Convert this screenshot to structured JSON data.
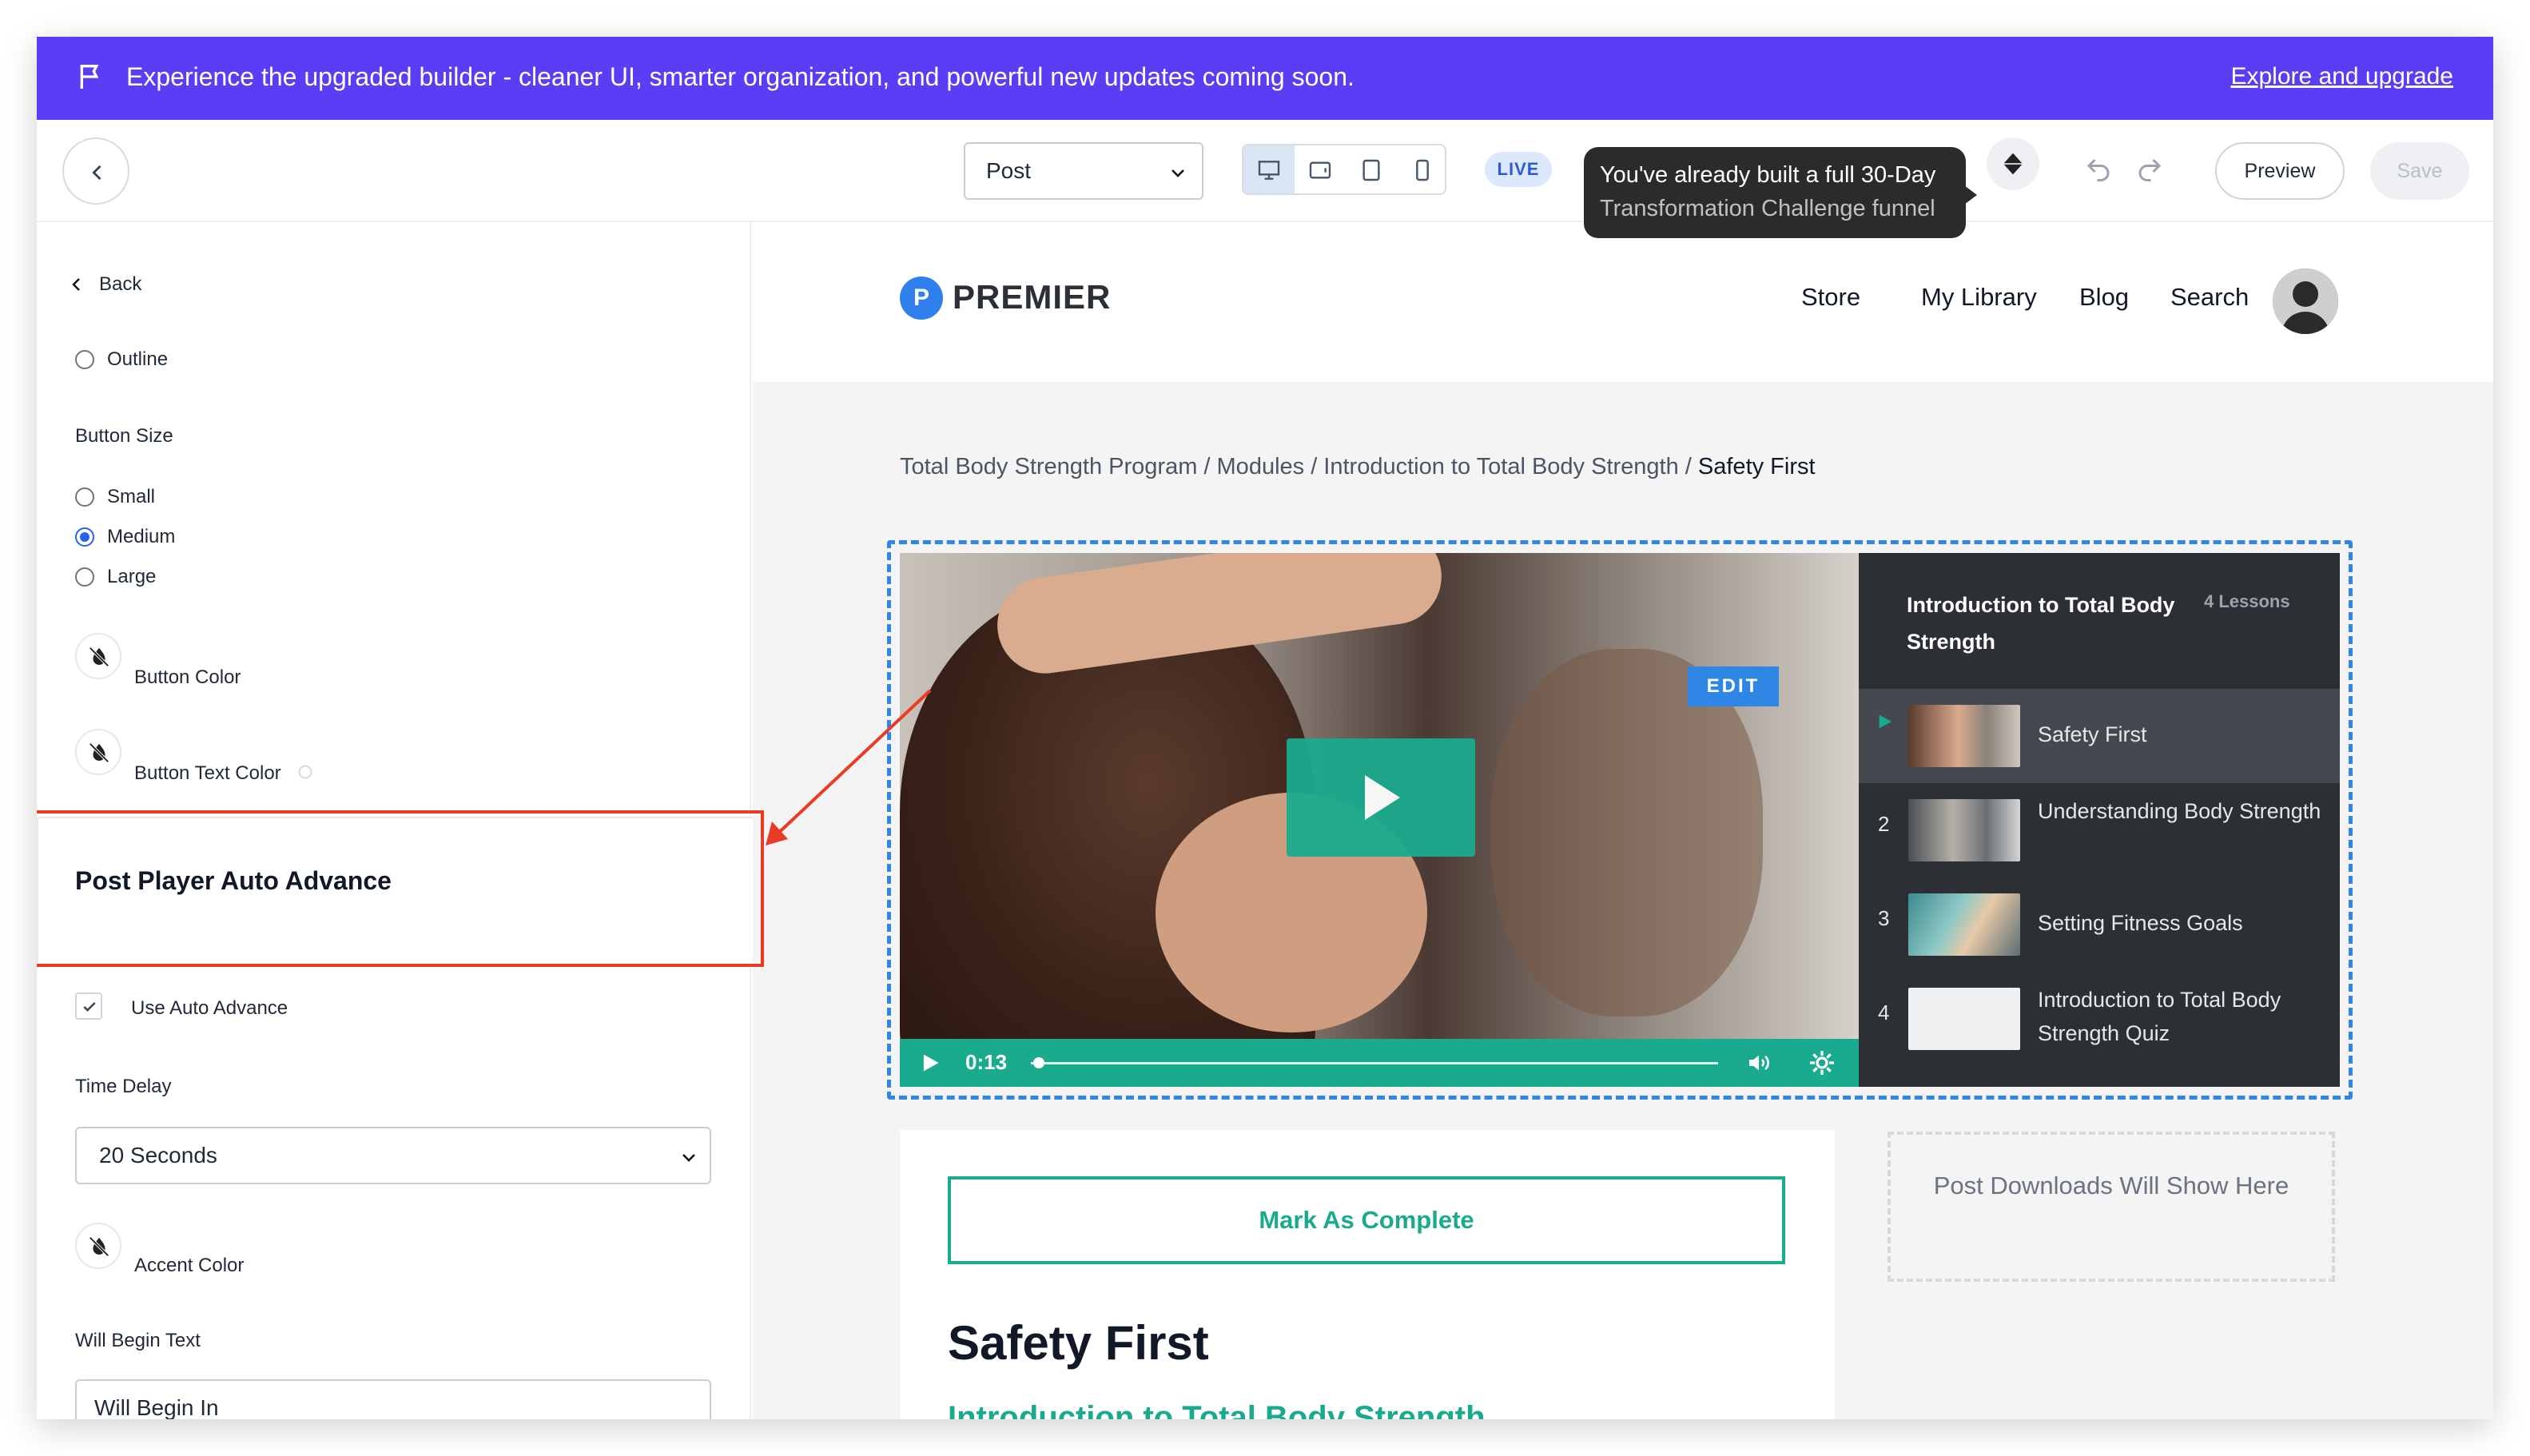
{
  "banner": {
    "message": "Experience the upgraded builder - cleaner UI, smarter organization, and powerful new updates coming soon.",
    "link": "Explore and upgrade",
    "color": "#5b3df5"
  },
  "toolbar": {
    "page_type": "Post",
    "status": "LIVE",
    "tooltip_line1": "You've already built a full 30-Day",
    "tooltip_line2": "Transformation Challenge funnel",
    "preview_label": "Preview",
    "save_label": "Save"
  },
  "sidebar": {
    "back_label": "Back",
    "outline_label": "Outline",
    "button_size_label": "Button Size",
    "sizes": [
      "Small",
      "Medium",
      "Large"
    ],
    "selected_size": "Medium",
    "button_color_label": "Button Color",
    "button_text_color_label": "Button Text Color",
    "section_title": "Post Player Auto Advance",
    "use_auto_advance_label": "Use Auto Advance",
    "use_auto_advance_checked": true,
    "time_delay_label": "Time Delay",
    "time_delay_value": "20 Seconds",
    "accent_color_label": "Accent Color",
    "will_begin_text_label": "Will Begin Text",
    "will_begin_text_value": "Will Begin In"
  },
  "site": {
    "logo_initial": "P",
    "logo_text": "PREMIER",
    "nav": [
      "Store",
      "My Library",
      "Blog",
      "Search"
    ],
    "breadcrumb": {
      "path": "Total Body Strength Program / Modules / Introduction to Total Body Strength / ",
      "current": "Safety First"
    }
  },
  "player": {
    "time": "0:13",
    "edit_label": "EDIT",
    "accent": "#1aaa8d",
    "progress": 0.01,
    "playlist_title": "Introduction to Total Body Strength",
    "lesson_count": "4 Lessons",
    "lessons": [
      {
        "num": "",
        "title": "Safety First",
        "active": true
      },
      {
        "num": "2",
        "title": "Understanding Body Strength",
        "active": false
      },
      {
        "num": "3",
        "title": "Setting Fitness Goals",
        "active": false
      },
      {
        "num": "4",
        "title": "Introduction to Total Body Strength Quiz",
        "active": false
      }
    ]
  },
  "content": {
    "mark_complete": "Mark As Complete",
    "title": "Safety First",
    "subtitle": "Introduction to Total Body Strength",
    "downloads_placeholder": "Post Downloads Will Show Here"
  },
  "icons": [
    "flag-icon",
    "chevron-left-icon",
    "desktop-icon",
    "tablet-landscape-icon",
    "tablet-portrait-icon",
    "mobile-icon",
    "diamond-icon",
    "undo-icon",
    "redo-icon",
    "no-color-icon",
    "info-icon",
    "check-icon",
    "play-icon",
    "volume-icon",
    "settings-gear-icon"
  ]
}
